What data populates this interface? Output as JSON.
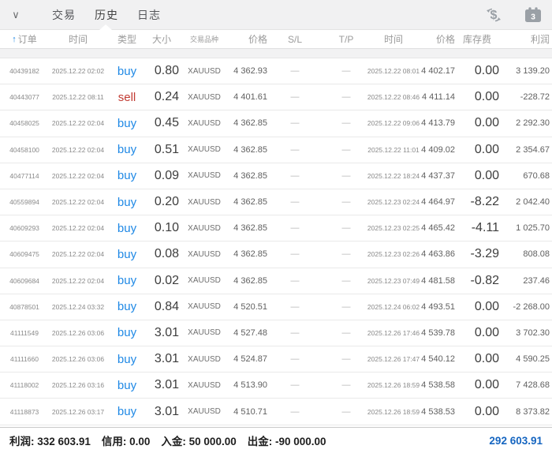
{
  "topbar": {
    "tabs": [
      {
        "id": "trade",
        "label": "交易",
        "active": false
      },
      {
        "id": "history",
        "label": "历史",
        "active": true
      },
      {
        "id": "journal",
        "label": "日志",
        "active": false
      }
    ],
    "calendar_badge": "3"
  },
  "table": {
    "headers": {
      "order": "订单",
      "time_open": "时间",
      "type": "类型",
      "volume": "大小",
      "symbol": "交易品种",
      "price_open": "价格",
      "sl": "S/L",
      "tp": "T/P",
      "time_close": "时间",
      "price_close": "价格",
      "swap": "库存费",
      "profit": "利润"
    },
    "sort": {
      "column": "order",
      "direction": "ascending"
    },
    "rows": [
      {
        "order": "40439182",
        "time_open": "2025.12.22 02:02",
        "type": "buy",
        "volume": "0.80",
        "symbol": "XAUUSD",
        "price_open": "4 362.93",
        "sl": "—",
        "tp": "—",
        "time_close": "2025.12.22 08:01",
        "price_close": "4 402.17",
        "swap": "0.00",
        "profit": "3 139.20"
      },
      {
        "order": "40443077",
        "time_open": "2025.12.22 08:11",
        "type": "sell",
        "volume": "0.24",
        "symbol": "XAUUSD",
        "price_open": "4 401.61",
        "sl": "—",
        "tp": "—",
        "time_close": "2025.12.22 08:46",
        "price_close": "4 411.14",
        "swap": "0.00",
        "profit": "-228.72"
      },
      {
        "order": "40458025",
        "time_open": "2025.12.22 02:04",
        "type": "buy",
        "volume": "0.45",
        "symbol": "XAUUSD",
        "price_open": "4 362.85",
        "sl": "—",
        "tp": "—",
        "time_close": "2025.12.22 09:06",
        "price_close": "4 413.79",
        "swap": "0.00",
        "profit": "2 292.30"
      },
      {
        "order": "40458100",
        "time_open": "2025.12.22 02:04",
        "type": "buy",
        "volume": "0.51",
        "symbol": "XAUUSD",
        "price_open": "4 362.85",
        "sl": "—",
        "tp": "—",
        "time_close": "2025.12.22 11:01",
        "price_close": "4 409.02",
        "swap": "0.00",
        "profit": "2 354.67"
      },
      {
        "order": "40477114",
        "time_open": "2025.12.22 02:04",
        "type": "buy",
        "volume": "0.09",
        "symbol": "XAUUSD",
        "price_open": "4 362.85",
        "sl": "—",
        "tp": "—",
        "time_close": "2025.12.22 18:24",
        "price_close": "4 437.37",
        "swap": "0.00",
        "profit": "670.68"
      },
      {
        "order": "40559894",
        "time_open": "2025.12.22 02:04",
        "type": "buy",
        "volume": "0.20",
        "symbol": "XAUUSD",
        "price_open": "4 362.85",
        "sl": "—",
        "tp": "—",
        "time_close": "2025.12.23 02:24",
        "price_close": "4 464.97",
        "swap": "-8.22",
        "profit": "2 042.40"
      },
      {
        "order": "40609293",
        "time_open": "2025.12.22 02:04",
        "type": "buy",
        "volume": "0.10",
        "symbol": "XAUUSD",
        "price_open": "4 362.85",
        "sl": "—",
        "tp": "—",
        "time_close": "2025.12.23 02:25",
        "price_close": "4 465.42",
        "swap": "-4.11",
        "profit": "1 025.70"
      },
      {
        "order": "40609475",
        "time_open": "2025.12.22 02:04",
        "type": "buy",
        "volume": "0.08",
        "symbol": "XAUUSD",
        "price_open": "4 362.85",
        "sl": "—",
        "tp": "—",
        "time_close": "2025.12.23 02:26",
        "price_close": "4 463.86",
        "swap": "-3.29",
        "profit": "808.08"
      },
      {
        "order": "40609684",
        "time_open": "2025.12.22 02:04",
        "type": "buy",
        "volume": "0.02",
        "symbol": "XAUUSD",
        "price_open": "4 362.85",
        "sl": "—",
        "tp": "—",
        "time_close": "2025.12.23 07:49",
        "price_close": "4 481.58",
        "swap": "-0.82",
        "profit": "237.46"
      },
      {
        "order": "40878501",
        "time_open": "2025.12.24 03:32",
        "type": "buy",
        "volume": "0.84",
        "symbol": "XAUUSD",
        "price_open": "4 520.51",
        "sl": "—",
        "tp": "—",
        "time_close": "2025.12.24 06:02",
        "price_close": "4 493.51",
        "swap": "0.00",
        "profit": "-2 268.00"
      },
      {
        "order": "41111549",
        "time_open": "2025.12.26 03:06",
        "type": "buy",
        "volume": "3.01",
        "symbol": "XAUUSD",
        "price_open": "4 527.48",
        "sl": "—",
        "tp": "—",
        "time_close": "2025.12.26 17:46",
        "price_close": "4 539.78",
        "swap": "0.00",
        "profit": "3 702.30"
      },
      {
        "order": "41111660",
        "time_open": "2025.12.26 03:06",
        "type": "buy",
        "volume": "3.01",
        "symbol": "XAUUSD",
        "price_open": "4 524.87",
        "sl": "—",
        "tp": "—",
        "time_close": "2025.12.26 17:47",
        "price_close": "4 540.12",
        "swap": "0.00",
        "profit": "4 590.25"
      },
      {
        "order": "41118002",
        "time_open": "2025.12.26 03:16",
        "type": "buy",
        "volume": "3.01",
        "symbol": "XAUUSD",
        "price_open": "4 513.90",
        "sl": "—",
        "tp": "—",
        "time_close": "2025.12.26 18:59",
        "price_close": "4 538.58",
        "swap": "0.00",
        "profit": "7 428.68"
      },
      {
        "order": "41118873",
        "time_open": "2025.12.26 03:17",
        "type": "buy",
        "volume": "3.01",
        "symbol": "XAUUSD",
        "price_open": "4 510.71",
        "sl": "—",
        "tp": "—",
        "time_close": "2025.12.26 18:59",
        "price_close": "4 538.53",
        "swap": "0.00",
        "profit": "8 373.82"
      }
    ]
  },
  "footer": {
    "profit_label": "利润:",
    "profit": "332 603.91",
    "credit_label": "信用:",
    "credit": "0.00",
    "deposit_label": "入金:",
    "deposit": "50 000.00",
    "withdrawal_label": "出金:",
    "withdrawal": "-90 000.00",
    "balance": "292 603.91"
  },
  "colors": {
    "buy": "#1e88e5",
    "sell": "#c23b33",
    "balance_blue": "#1565c0",
    "topbar_bg": "#f1f1f2",
    "icon_gray": "#9aa0a6"
  }
}
